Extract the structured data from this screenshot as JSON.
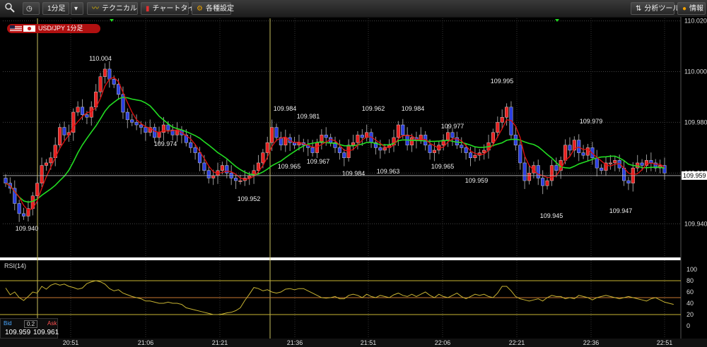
{
  "toolbar": {
    "interval": "1分足",
    "technical": "テクニカル",
    "chart_type": "チャートタイプ",
    "settings": "各種設定",
    "analysis": "分析ツール",
    "info": "情報"
  },
  "pair_label": "USD/JPY 1分足",
  "rsi_label": "RSI(14)",
  "price_box": {
    "bid_label": "Bid",
    "spread": "0.2",
    "ask_label": "Ask",
    "bid": "109.959",
    "ask": "109.961"
  },
  "current_price": "109.959",
  "colors": {
    "up": "#e8201f",
    "down": "#2b3fe0",
    "ma_fast": "#e01010",
    "ma_slow": "#22dd22",
    "rsi_line": "#c8b432"
  },
  "chart_data": {
    "type": "candlestick",
    "yticks": [
      "110.020",
      "110.000",
      "109.980",
      "109.960",
      "109.940"
    ],
    "ylim": [
      109.927,
      110.021
    ],
    "xticks": [
      "20:51",
      "21:06",
      "21:21",
      "21:36",
      "21:51",
      "22:06",
      "22:21",
      "22:36",
      "22:51"
    ],
    "rsi_ticks": [
      "100",
      "80",
      "60",
      "40",
      "20",
      "0"
    ],
    "rsi_levels": [
      80,
      50,
      20
    ],
    "price_annotations": [
      "110.004",
      "109.974",
      "109.952",
      "109.984",
      "109.965",
      "109.981",
      "109.967",
      "109.984",
      "109.962",
      "109.963",
      "109.984",
      "109.965",
      "109.977",
      "109.959",
      "109.995",
      "109.945",
      "109.979",
      "109.947",
      "109.940"
    ],
    "close": [
      109.956,
      109.954,
      109.948,
      109.944,
      109.943,
      109.946,
      109.951,
      109.956,
      109.963,
      109.964,
      109.966,
      109.971,
      109.978,
      109.975,
      109.976,
      109.984,
      109.986,
      109.983,
      109.982,
      109.986,
      109.992,
      109.998,
      110.001,
      109.997,
      109.995,
      109.991,
      109.984,
      109.981,
      109.98,
      109.979,
      109.978,
      109.976,
      109.978,
      109.974,
      109.976,
      109.979,
      109.977,
      109.975,
      109.977,
      109.975,
      109.972,
      109.97,
      109.968,
      109.964,
      109.961,
      109.958,
      109.959,
      109.961,
      109.963,
      109.96,
      109.958,
      109.957,
      109.957,
      109.958,
      109.959,
      109.961,
      109.964,
      109.968,
      109.972,
      109.978,
      109.974,
      109.971,
      109.974,
      109.972,
      109.971,
      109.972,
      109.971,
      109.97,
      109.968,
      109.972,
      109.975,
      109.974,
      109.972,
      109.97,
      109.968,
      109.966,
      109.971,
      109.972,
      109.975,
      109.974,
      109.976,
      109.972,
      109.97,
      109.969,
      109.97,
      109.971,
      109.974,
      109.979,
      109.975,
      109.971,
      109.974,
      109.973,
      109.975,
      109.971,
      109.968,
      109.969,
      109.971,
      109.973,
      109.976,
      109.974,
      109.971,
      109.97,
      109.968,
      109.966,
      109.967,
      109.968,
      109.969,
      109.972,
      109.976,
      109.98,
      109.982,
      109.986,
      109.975,
      109.971,
      109.964,
      109.957,
      109.96,
      109.963,
      109.958,
      109.955,
      109.957,
      109.963,
      109.961,
      109.965,
      109.971,
      109.969,
      109.973,
      109.968,
      109.967,
      109.97,
      109.966,
      109.962,
      109.961,
      109.964,
      109.964,
      109.965,
      109.962,
      109.957,
      109.956,
      109.962,
      109.964,
      109.963,
      109.965,
      109.964,
      109.962,
      109.963,
      109.96
    ],
    "open": [
      109.958,
      109.956,
      109.954,
      109.948,
      109.944,
      109.943,
      109.946,
      109.951,
      109.956,
      109.963,
      109.964,
      109.966,
      109.971,
      109.978,
      109.975,
      109.976,
      109.984,
      109.986,
      109.983,
      109.982,
      109.986,
      109.992,
      109.998,
      110.001,
      109.997,
      109.995,
      109.991,
      109.984,
      109.981,
      109.98,
      109.979,
      109.978,
      109.976,
      109.978,
      109.974,
      109.976,
      109.979,
      109.977,
      109.975,
      109.977,
      109.975,
      109.972,
      109.97,
      109.968,
      109.964,
      109.961,
      109.958,
      109.959,
      109.961,
      109.963,
      109.96,
      109.958,
      109.957,
      109.957,
      109.958,
      109.959,
      109.961,
      109.964,
      109.968,
      109.972,
      109.978,
      109.974,
      109.971,
      109.974,
      109.972,
      109.971,
      109.972,
      109.971,
      109.97,
      109.968,
      109.972,
      109.975,
      109.974,
      109.972,
      109.97,
      109.968,
      109.966,
      109.971,
      109.972,
      109.975,
      109.974,
      109.976,
      109.972,
      109.97,
      109.969,
      109.97,
      109.971,
      109.974,
      109.979,
      109.975,
      109.971,
      109.974,
      109.973,
      109.975,
      109.971,
      109.968,
      109.969,
      109.971,
      109.973,
      109.976,
      109.974,
      109.971,
      109.97,
      109.968,
      109.966,
      109.967,
      109.968,
      109.969,
      109.972,
      109.976,
      109.98,
      109.982,
      109.986,
      109.975,
      109.971,
      109.964,
      109.957,
      109.96,
      109.963,
      109.958,
      109.955,
      109.957,
      109.963,
      109.961,
      109.965,
      109.971,
      109.969,
      109.973,
      109.968,
      109.967,
      109.97,
      109.966,
      109.962,
      109.961,
      109.964,
      109.964,
      109.965,
      109.962,
      109.957,
      109.956,
      109.962,
      109.964,
      109.963,
      109.965,
      109.964,
      109.962,
      109.963
    ],
    "rsi": [
      67,
      55,
      60,
      50,
      45,
      52,
      60,
      58,
      70,
      65,
      72,
      75,
      72,
      74,
      70,
      68,
      65,
      67,
      75,
      78,
      80,
      78,
      74,
      66,
      62,
      64,
      58,
      55,
      52,
      50,
      48,
      44,
      44,
      42,
      40,
      40,
      42,
      40,
      40,
      38,
      32,
      30,
      28,
      26,
      24,
      22,
      20,
      20,
      21,
      23,
      24,
      27,
      32,
      45,
      56,
      68,
      66,
      62,
      64,
      60,
      58,
      60,
      65,
      66,
      64,
      66,
      66,
      62,
      58,
      54,
      50,
      49,
      50,
      52,
      48,
      48,
      54,
      56,
      54,
      50,
      56,
      52,
      50,
      54,
      52,
      50,
      55,
      58,
      54,
      52,
      56,
      52,
      56,
      60,
      54,
      50,
      56,
      52,
      50,
      54,
      58,
      52,
      48,
      52,
      56,
      54,
      56,
      52,
      50,
      58,
      70,
      70,
      62,
      52,
      48,
      46,
      44,
      46,
      48,
      44,
      50,
      54,
      52,
      52,
      48,
      50,
      48,
      54,
      52,
      50,
      46,
      50,
      52,
      54,
      52,
      50,
      48,
      50,
      52,
      50,
      48,
      46,
      44,
      48,
      50,
      46,
      42,
      40,
      38
    ]
  }
}
